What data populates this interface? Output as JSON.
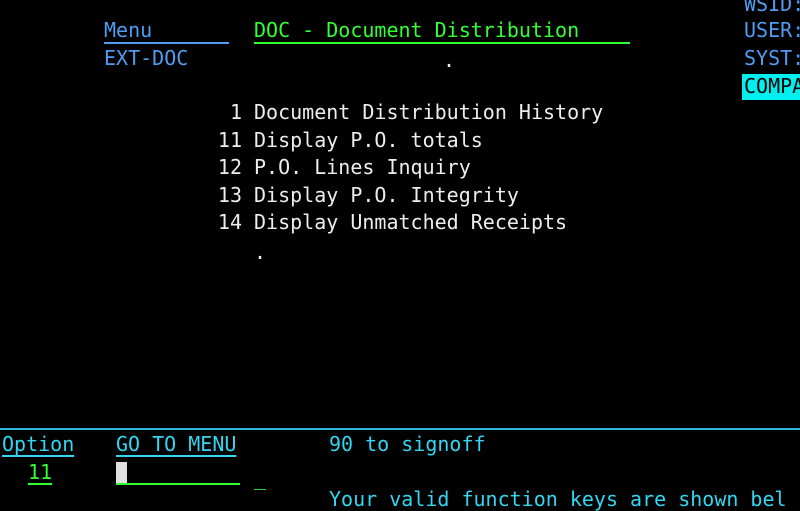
{
  "header": {
    "menu_label": "Menu",
    "menu_name": "EXT-DOC",
    "title": "DOC - Document Distribution",
    "title_dot": ".",
    "right_labels": [
      "WSID:",
      "USER:",
      "SYST:"
    ],
    "company_label": "COMPA"
  },
  "menu": {
    "items": [
      {
        "number": "1",
        "label": "Document Distribution History"
      },
      {
        "number": "11",
        "label": "Display P.O. totals"
      },
      {
        "number": "12",
        "label": "P.O. Lines Inquiry"
      },
      {
        "number": "13",
        "label": "Display P.O. Integrity"
      },
      {
        "number": "14",
        "label": "Display Unmatched Receipts"
      }
    ],
    "end_dot": "."
  },
  "footer": {
    "option_label": "Option",
    "option_value": "11",
    "goto_label": "GO TO MENU",
    "goto_value": "",
    "trailing_char": "_",
    "signoff_text": "90 to signoff",
    "function_keys_text": "Your valid function keys are shown bel"
  },
  "colors": {
    "background": "#000000",
    "label_blue": "#4F9DF2",
    "input_green": "#33FF33",
    "text_white": "#EDEDED",
    "divider_cyan": "#2FB8D6",
    "company_highlight": "#00F0F0"
  }
}
